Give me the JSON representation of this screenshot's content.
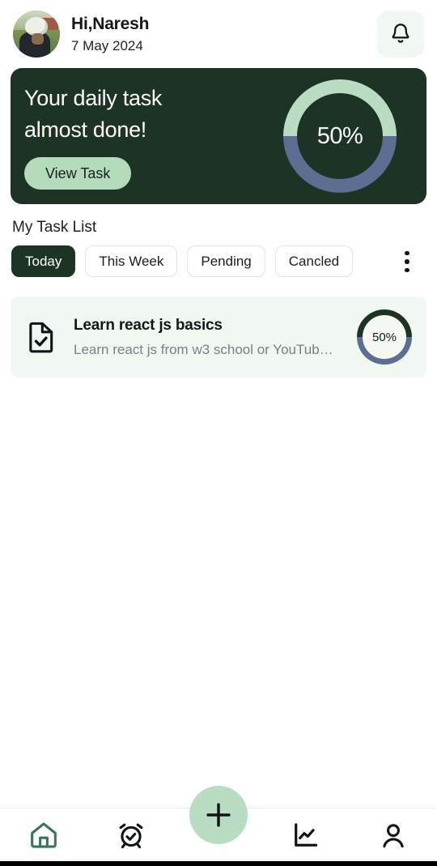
{
  "header": {
    "avatar_alt": "user-avatar-photo",
    "greeting": "Hi,Naresh",
    "date": "7 May 2024",
    "notification_icon": "bell-icon"
  },
  "banner": {
    "title_line1": "Your daily task",
    "title_line2": "almost done!",
    "cta_label": "View Task",
    "progress_label": "50%",
    "progress_value": 50,
    "bg_color": "#1c3326",
    "progress_track_color": "#5d6e92",
    "progress_fill_color": "#b9dcc2",
    "cta_color": "#b5dbbd"
  },
  "task_section": {
    "title": "My Task List",
    "filters": [
      {
        "label": "Today",
        "active": true
      },
      {
        "label": "This Week",
        "active": false
      },
      {
        "label": "Pending",
        "active": false
      },
      {
        "label": "Cancled",
        "active": false
      }
    ],
    "menu_icon": "kebab-menu-icon",
    "tasks": [
      {
        "icon": "document-check-icon",
        "title": "Learn react js basics",
        "subtitle": "Learn react js from w3 school or YouTub…",
        "progress_label": "50%",
        "progress_value": 50
      }
    ]
  },
  "bottom_nav": {
    "items": [
      {
        "icon": "home-icon",
        "active": true
      },
      {
        "icon": "alarm-check-icon",
        "active": false
      },
      {
        "icon": "line-chart-icon",
        "active": false
      },
      {
        "icon": "person-icon",
        "active": false
      }
    ],
    "fab": {
      "icon": "plus-icon",
      "label": "+",
      "color": "#b9dcc2"
    },
    "active_color": "#3a7355",
    "inactive_color": "#111417"
  }
}
